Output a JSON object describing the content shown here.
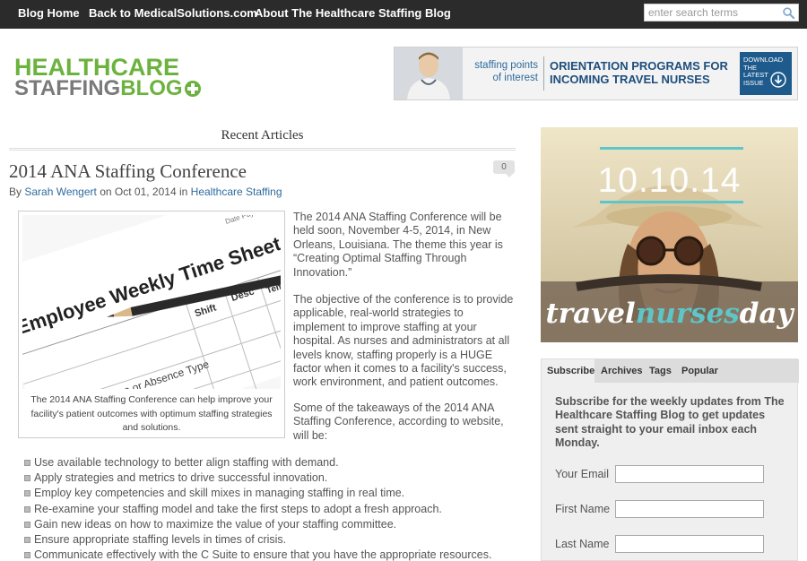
{
  "topnav": {
    "links": [
      "Blog Home",
      "Back to MedicalSolutions.com",
      "About The Healthcare Staffing Blog"
    ],
    "search_placeholder": "enter search terms"
  },
  "logo": {
    "line1": "HEALTHCARE",
    "line2a": "STAFFING",
    "line2b": "BLOG"
  },
  "banner": {
    "small_text": "staffing points of interest",
    "headline": "ORIENTATION PROGRAMS FOR INCOMING TRAVEL NURSES",
    "button_text": "DOWNLOAD THE LATEST ISSUE"
  },
  "main": {
    "section_title": "Recent Articles",
    "article": {
      "title": "2014 ANA Staffing Conference",
      "comment_count": "0",
      "byline_prefix": "By",
      "author": "Sarah Wengert",
      "byline_on": "on",
      "date": "Oct 01, 2014",
      "byline_in": "in",
      "category": "Healthcare Staffing",
      "figure": {
        "sheet_title": "Employee Weekly Time Sheet",
        "col_shift": "Shift",
        "col_desc": "Desc",
        "col_temp": "Temp",
        "row_label": "Attendance or Absence Type",
        "pay_week": "Date Pay Week",
        "caption": "The 2014 ANA Staffing Conference can help improve your facility's patient outcomes with optimum staffing strategies and solutions."
      },
      "paragraphs": [
        "The 2014 ANA Staffing Conference will be held soon, November 4-5, 2014, in New Orleans, Louisiana. The theme this year is “Creating Optimal Staffing Through Innovation.”",
        "The objective of the conference is to provide applicable, real-world strategies to implement to improve staffing at your hospital. As nurses and administrators at all levels know, staffing properly is a HUGE factor when it comes to a facility's success, work environment, and patient outcomes.",
        "Some of the takeaways of the 2014 ANA Staffing Conference, according to website, will be:"
      ],
      "bullets": [
        "Use available technology to better align staffing with demand.",
        "Apply strategies and metrics to drive successful innovation.",
        "Employ key competencies and skill mixes in managing staffing in real time.",
        "Re-examine your staffing model and take the first steps to adopt a fresh approach.",
        "Gain new ideas on how to maximize the value of your staffing committee.",
        "Ensure appropriate staffing levels in times of crisis.",
        "Communicate effectively with the C Suite to ensure that you have the appropriate resources."
      ]
    }
  },
  "sidebar": {
    "promo": {
      "date": "10.10.14",
      "tagline_a": "travel",
      "tagline_b": "nurses",
      "tagline_c": "day"
    },
    "tabs": [
      "Subscribe",
      "Archives",
      "Tags",
      "Popular"
    ],
    "subscribe_text": "Subscribe for the weekly updates from The Healthcare Staffing Blog to get updates sent straight to your email inbox each Monday.",
    "fields": [
      "Your Email",
      "First Name",
      "Last Name"
    ]
  },
  "colors": {
    "topbar": "#2b2b2b",
    "logo_green": "#6cb23e",
    "logo_gray": "#7a7a7a",
    "link_blue": "#2e6b9e",
    "banner_blue": "#1d4e7c",
    "widget_bg": "#efefef"
  }
}
